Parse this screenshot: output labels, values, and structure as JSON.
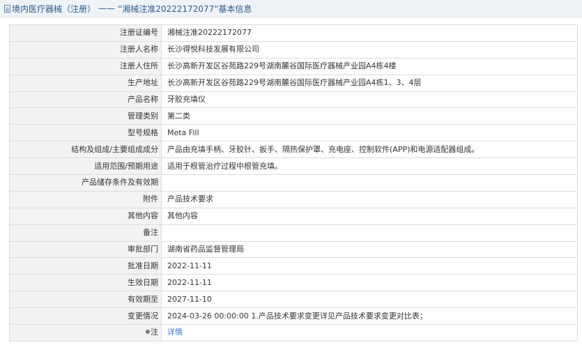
{
  "header": {
    "breadcrumb": "境内医疗器械（注册）",
    "separator": "——",
    "record_title": "“湘械注准20222172077”基本信息"
  },
  "rows": [
    {
      "label": "注册证编号",
      "value": "湘械注准20222172077"
    },
    {
      "label": "注册人名称",
      "value": "长沙得悦科技发展有限公司"
    },
    {
      "label": "注册人住所",
      "value": "长沙高新开发区谷苑路229号湖南麓谷国际医疗器械产业园A4栋4楼"
    },
    {
      "label": "生产地址",
      "value": "长沙高新开发区谷苑路229号湖南麓谷国际医疗器械产业园A4栋1、3、4层"
    },
    {
      "label": "产品名称",
      "value": "牙胶充填仪"
    },
    {
      "label": "管理类别",
      "value": "第二类"
    },
    {
      "label": "型号规格",
      "value": "Meta Fill"
    },
    {
      "label": "结构及组成/主要组成成分",
      "value": "产品由充填手柄、牙胶针、扳手、隔热保护罩、充电座、控制软件(APP)和电源适配器组成。"
    },
    {
      "label": "适用范围/预期用途",
      "value": "适用于根管治疗过程中根管充填。"
    },
    {
      "label": "产品储存条件及有效期",
      "value": ""
    },
    {
      "label": "附件",
      "value": "产品技术要求"
    },
    {
      "label": "其他内容",
      "value": "其他内容"
    },
    {
      "label": "备注",
      "value": ""
    },
    {
      "label": "审批部门",
      "value": "湖南省药品监督管理局"
    },
    {
      "label": "批准日期",
      "value": "2022-11-11"
    },
    {
      "label": "生效日期",
      "value": "2022-11-11"
    },
    {
      "label": "有效期至",
      "value": "2027-11-10"
    },
    {
      "label": "变更情况",
      "value": "2024-03-26 00:00:00 1.产品技术要求变更详见产品技术要求变更对比表；"
    }
  ],
  "note_row": {
    "label": "注",
    "link_text": "详情",
    "icon": "pin-icon"
  }
}
